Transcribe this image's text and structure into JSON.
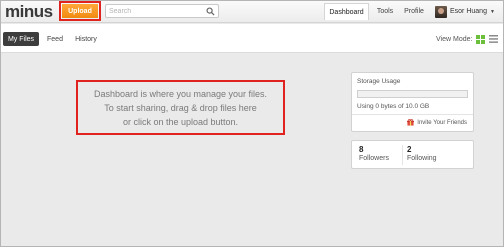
{
  "app": {
    "logo": "minus"
  },
  "header": {
    "upload_label": "Upload",
    "search_placeholder": "Search",
    "nav": [
      "Dashboard",
      "Tools",
      "Profile"
    ],
    "active_nav": "Dashboard",
    "user_name": "Esor Huang"
  },
  "subnav": {
    "tabs": [
      "My Files",
      "Feed",
      "History"
    ],
    "active_tab": "My Files",
    "view_mode_label": "View Mode:"
  },
  "dropzone": {
    "lines": [
      "Dashboard is where you manage your files.",
      "To start sharing, drag & drop files here",
      "or click on the upload button."
    ]
  },
  "storage": {
    "title": "Storage Usage",
    "usage_text": "Using 0 bytes of 10.0 GB",
    "used_fraction": 0,
    "invite_label": "Invite Your Friends"
  },
  "social": {
    "followers_count": "8",
    "followers_label": "Followers",
    "following_count": "2",
    "following_label": "Following"
  },
  "colors": {
    "upload": "#f08a10",
    "highlight_border": "#e0231e",
    "grid_view_active": "#6cbf3a"
  }
}
